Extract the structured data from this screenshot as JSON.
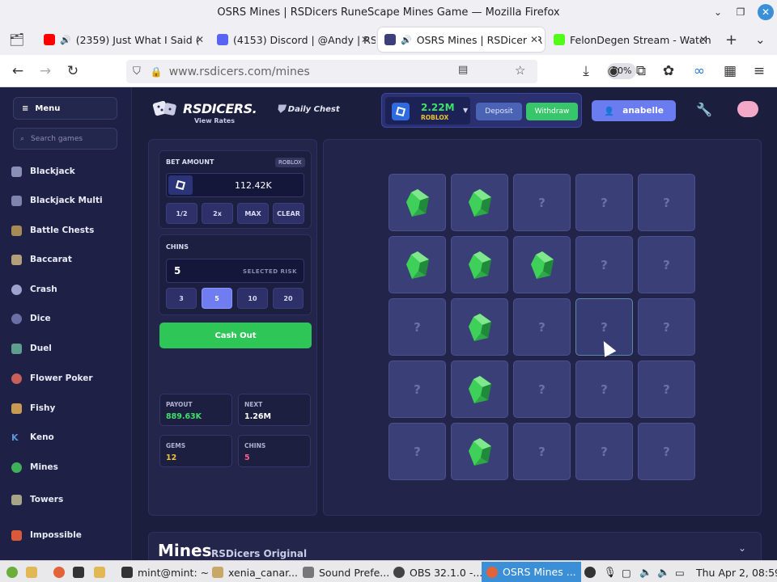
{
  "window": {
    "title": "OSRS Mines | RSDicers RuneScape Mines Game — Mozilla Firefox"
  },
  "tabs": [
    {
      "label": "(2359) Just What I Said (",
      "icon": "youtube-icon",
      "color": "#ff0000"
    },
    {
      "label": "(4153) Discord | @Andy | RS",
      "icon": "discord-icon",
      "color": "#5865f2"
    },
    {
      "label": "OSRS Mines | RSDicers R",
      "icon": "rsdicers-icon",
      "color": "#3d3f7a"
    },
    {
      "label": "FelonDegen Stream - Watch",
      "icon": "kick-icon",
      "color": "#53fc18"
    }
  ],
  "nav": {
    "url_host": "www.rsdicers.com",
    "url_path": "/mines",
    "zoom": "70%"
  },
  "site": {
    "logo": "RSDICERS.",
    "view_rates": "View Rates",
    "daily_chest": "Daily Chest",
    "wallet": {
      "balance": "2.22M",
      "currency": "ROBLOX",
      "deposit": "Deposit",
      "withdraw": "Withdraw"
    },
    "username": "anabelle",
    "sidebar": {
      "menu_label": "Menu",
      "search_placeholder": "Search games",
      "items": [
        "Blackjack",
        "Blackjack Multi",
        "Battle Chests",
        "Baccarat",
        "Crash",
        "Dice",
        "Duel",
        "Flower Poker",
        "Fishy",
        "Keno",
        "Mines",
        "Towers",
        "Impossible"
      ]
    },
    "controls": {
      "bet_label": "BET AMOUNT",
      "bet_tag": "ROBLOX",
      "bet_value": "112.42K",
      "bet_buttons": [
        "1/2",
        "2x",
        "MAX",
        "CLEAR"
      ],
      "chins_label": "CHINS",
      "chins_value": "5",
      "selected_risk": "SELECTED RISK",
      "risk_options": [
        "3",
        "5",
        "10",
        "20"
      ],
      "risk_selected": "5",
      "cashout_label": "Cash Out"
    },
    "stats": {
      "payout_label": "PAYOUT",
      "payout": "889.63K",
      "next_label": "NEXT",
      "next": "1.26M",
      "gems_label": "GEMS",
      "gems": "12",
      "chins_label": "CHINS",
      "chins": "5"
    },
    "grid": [
      [
        "gem",
        "gem",
        "?",
        "?",
        "?"
      ],
      [
        "gem",
        "gem",
        "gem",
        "?",
        "?"
      ],
      [
        "?",
        "gem",
        "?",
        "?",
        "?"
      ],
      [
        "?",
        "gem",
        "?",
        "?",
        "?"
      ],
      [
        "?",
        "gem",
        "?",
        "?",
        "?"
      ]
    ],
    "footer": {
      "title": "Mines",
      "subtitle": "RSDicers Original"
    }
  },
  "taskbar": {
    "items": [
      "mint@mint: ~",
      "xenia_canar...",
      "Sound Prefe...",
      "OBS 32.1.0 -...",
      "OSRS Mines ..."
    ],
    "clock": "Thu Apr  2, 08:59"
  },
  "colors": {
    "accent": "#6b7bf0",
    "green": "#2fc658",
    "gem_green": "#3fd05a",
    "payout": "#3fe06a",
    "next": "#ffffff",
    "gems": "#e8c436",
    "chins": "#ff5a8a"
  }
}
